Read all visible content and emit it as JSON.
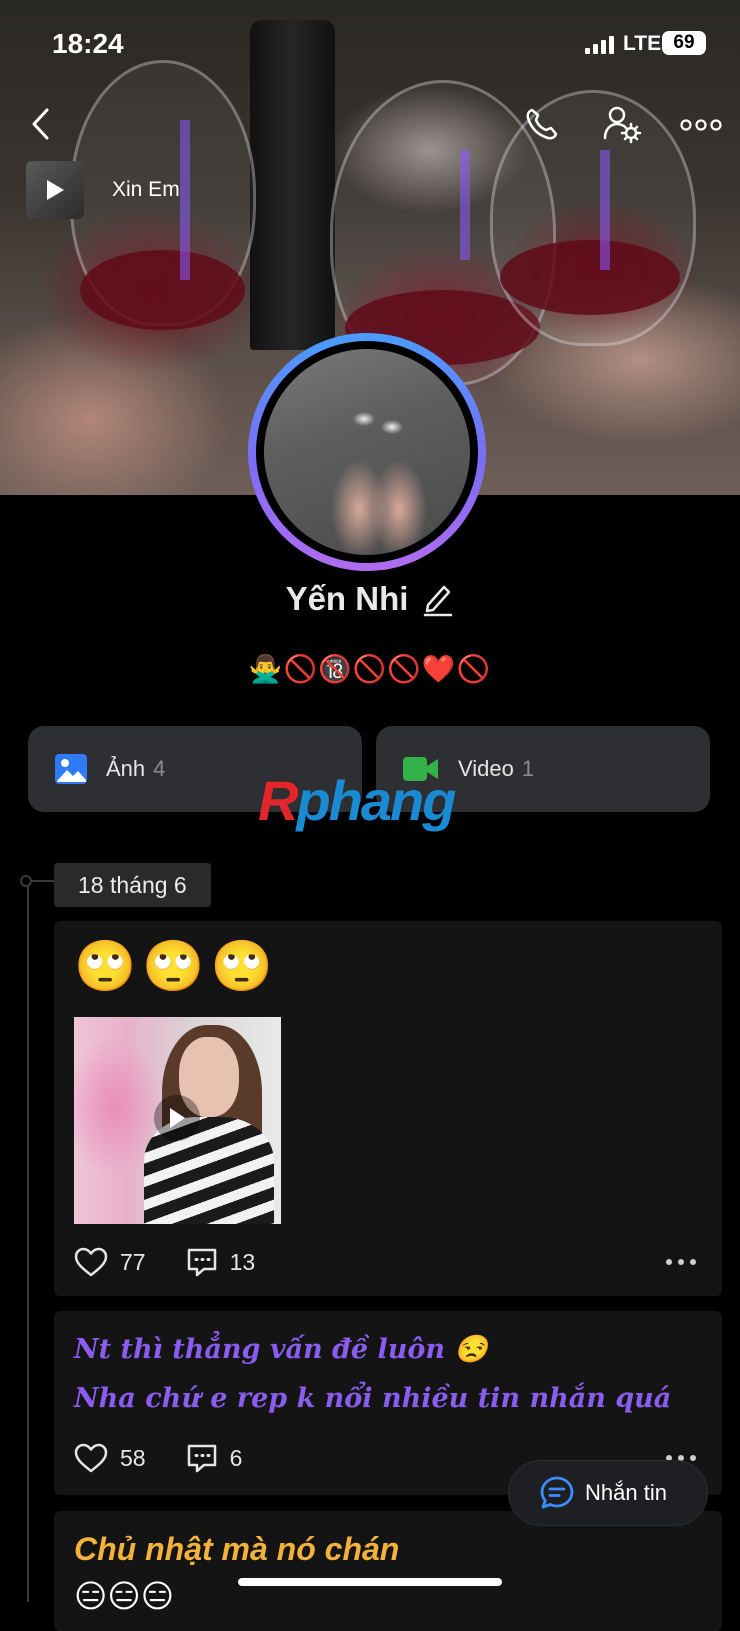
{
  "status_bar": {
    "time": "18:24",
    "network": "LTE",
    "battery": "69"
  },
  "cover": {
    "music": {
      "title": "Xin Em"
    }
  },
  "profile": {
    "name": "Yến Nhi",
    "bio": "🙅‍♂️🚫🔞🚫🚫❤️🚫"
  },
  "media": {
    "photos": {
      "label": "Ảnh",
      "count": "4"
    },
    "videos": {
      "label": "Video",
      "count": "1"
    }
  },
  "watermark": {
    "part1": "R",
    "part2": "phang"
  },
  "timeline": {
    "date": "18 tháng 6",
    "posts": [
      {
        "text": "🙄🙄🙄",
        "likes": "77",
        "comments": "13"
      },
      {
        "line1": "Nt thì thẳng vấn đề luôn 😒",
        "line2": "Nha chứ e rep k nổi nhiều tin nhắn quá",
        "likes": "58",
        "comments": "6"
      },
      {
        "text": "Chủ nhật mà nó chán",
        "emoji": "😑😑😑"
      }
    ]
  },
  "chat_button": {
    "label": "Nhắn tin"
  },
  "colors": {
    "accent_blue": "#4a9cff",
    "accent_purple": "#8a5cf0",
    "accent_orange": "#f4b23a"
  },
  "icons": [
    "back-icon",
    "phone-icon",
    "profile-settings-icon",
    "more-icon",
    "play-icon",
    "edit-icon",
    "image-icon",
    "video-icon",
    "heart-icon",
    "comment-icon",
    "chat-icon"
  ]
}
